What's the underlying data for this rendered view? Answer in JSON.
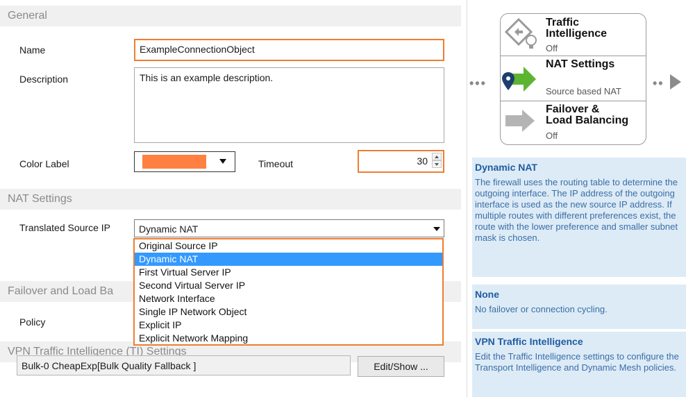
{
  "sections": {
    "general": "General",
    "nat": "NAT Settings",
    "failover": "Failover and Load Ba",
    "vpn": "VPN Traffic Intelligence (TI) Settings"
  },
  "general": {
    "name_label": "Name",
    "name_value": "ExampleConnectionObject",
    "description_label": "Description",
    "description_value": "This is an example description.",
    "color_label": "Color Label",
    "color_value": "#ff8040",
    "timeout_label": "Timeout",
    "timeout_value": "30"
  },
  "nat": {
    "translated_label": "Translated Source IP",
    "selected": "Dynamic NAT",
    "options": [
      "Original Source IP",
      "Dynamic NAT",
      "First Virtual Server IP",
      "Second Virtual Server IP",
      "Network Interface",
      "Single IP Network Object",
      "Explicit IP",
      "Explicit Network Mapping"
    ]
  },
  "failover": {
    "policy_label": "Policy"
  },
  "vpn": {
    "value": "Bulk-0 CheapExp[Bulk Quality Fallback ]",
    "button": "Edit/Show ..."
  },
  "flow": {
    "ti_title_1": "Traffic",
    "ti_title_2": "Intelligence",
    "ti_status": "Off",
    "nat_title": "NAT Settings",
    "nat_status": "Source based NAT",
    "fo_title_1": "Failover &",
    "fo_title_2": "Load Balancing",
    "fo_status": "Off",
    "dots_left": "•••",
    "dots_right": "••"
  },
  "info": {
    "nat_title": "Dynamic NAT",
    "nat_text": "The firewall uses the routing table to determine the outgoing interface. The IP address of the outgoing interface is used as the new source IP address. If multiple routes with different preferences exist, the route with the lower preference and smaller subnet mask is chosen.",
    "none_title": "None",
    "none_text": "No failover or connection cycling.",
    "vpn_title": "VPN Traffic Intelligence",
    "vpn_text": "Edit the Traffic Intelligence settings to configure the Transport Intelligence and Dynamic Mesh policies."
  },
  "colors": {
    "accent_orange": "#ee7d30",
    "selection_blue": "#3399ff",
    "info_bg": "#ddebf7",
    "nat_arrow_green": "#5cb531"
  }
}
